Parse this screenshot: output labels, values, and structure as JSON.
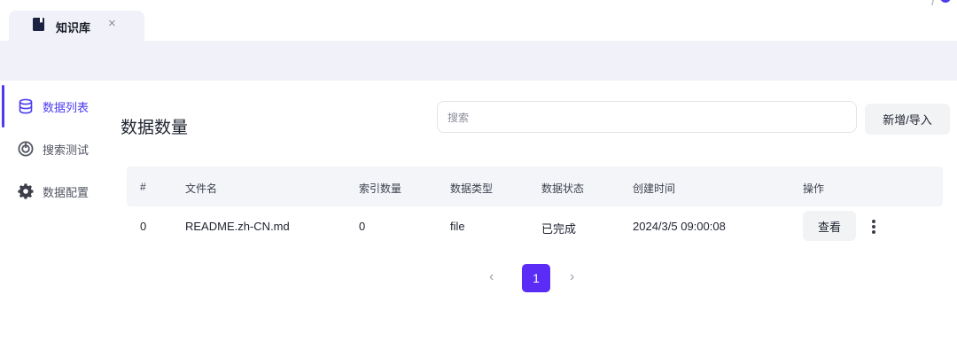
{
  "tab": {
    "title": "知识库",
    "close_glyph": "×",
    "icon": "book-icon"
  },
  "sidebar": {
    "items": [
      {
        "label": "数据列表",
        "icon": "database-icon",
        "active": true
      },
      {
        "label": "搜索测试",
        "icon": "search-test-icon",
        "active": false
      },
      {
        "label": "数据配置",
        "icon": "gear-icon",
        "active": false
      }
    ]
  },
  "main": {
    "title": "数据数量",
    "search_placeholder": "搜索",
    "add_button": "新增/导入"
  },
  "table": {
    "headers": [
      "#",
      "文件名",
      "索引数量",
      "数据类型",
      "数据状态",
      "创建时间",
      "操作"
    ],
    "rows": [
      {
        "index": "0",
        "filename": "README.zh-CN.md",
        "index_count": "0",
        "type": "file",
        "status": "已完成",
        "created": "2024/3/5 09:00:08",
        "action": "查看"
      }
    ]
  },
  "pagination": {
    "prev": "‹",
    "current": "1",
    "next": "›"
  },
  "colors": {
    "accent": "#4b3cf0",
    "page_active": "#5b2cf5",
    "band": "#f0f1f9"
  }
}
